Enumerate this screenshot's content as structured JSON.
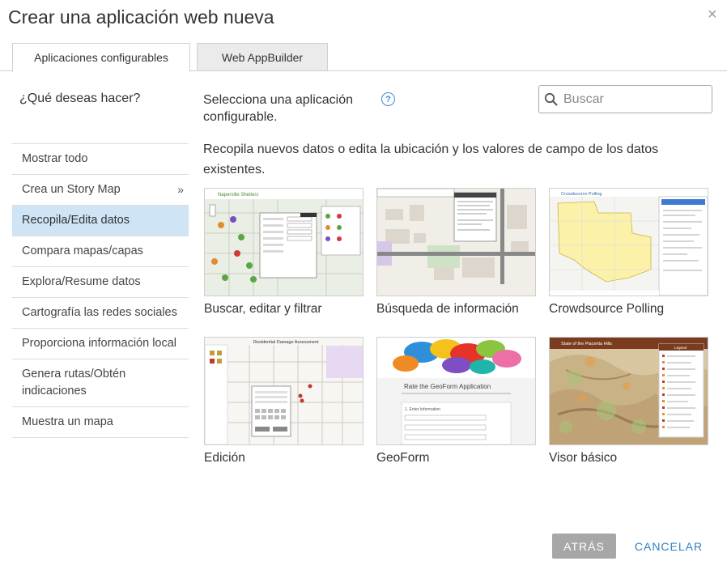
{
  "dialog": {
    "title": "Crear una aplicación web nueva",
    "close_icon": "×"
  },
  "tabs": [
    {
      "label": "Aplicaciones configurables",
      "active": true
    },
    {
      "label": "Web AppBuilder",
      "active": false
    }
  ],
  "sidebar": {
    "question": "¿Qué deseas hacer?",
    "chevron": "»",
    "items": [
      {
        "label": "Mostrar todo"
      },
      {
        "label": "Crea un Story Map",
        "has_submenu": true
      },
      {
        "label": "Recopila/Edita datos",
        "active": true
      },
      {
        "label": "Compara mapas/capas"
      },
      {
        "label": "Explora/Resume datos"
      },
      {
        "label": "Cartografía las redes sociales"
      },
      {
        "label": "Proporciona información local"
      },
      {
        "label": "Genera rutas/Obtén indicaciones"
      },
      {
        "label": "Muestra un mapa"
      }
    ]
  },
  "main": {
    "select_label": "Selecciona una aplicación configurable.",
    "help_icon": "?",
    "search": {
      "placeholder": "Buscar",
      "value": ""
    },
    "description": "Recopila nuevos datos o edita la ubicación y los valores de campo de los datos existentes.",
    "apps": [
      {
        "label": "Buscar, editar y filtrar",
        "thumb_title": "Naperville Shelters"
      },
      {
        "label": "Búsqueda de información"
      },
      {
        "label": "Crowdsource Polling",
        "thumb_title": "Crowdsource Polling"
      },
      {
        "label": "Edición",
        "thumb_title": "Residential Damage Assessment"
      },
      {
        "label": "GeoForm",
        "thumb_title": "Rate the GeoForm Application",
        "thumb_field": "1. Enter Information"
      },
      {
        "label": "Visor básico",
        "thumb_title": "State of the Placerita Hills",
        "thumb_legend": "Legend"
      }
    ]
  },
  "footer": {
    "back_label": "ATRÁS",
    "cancel_label": "CANCELAR"
  },
  "colors": {
    "accent": "#2e7fc6",
    "active_item_bg": "#cfe4f5",
    "back_button_bg": "#a7a7a7"
  }
}
